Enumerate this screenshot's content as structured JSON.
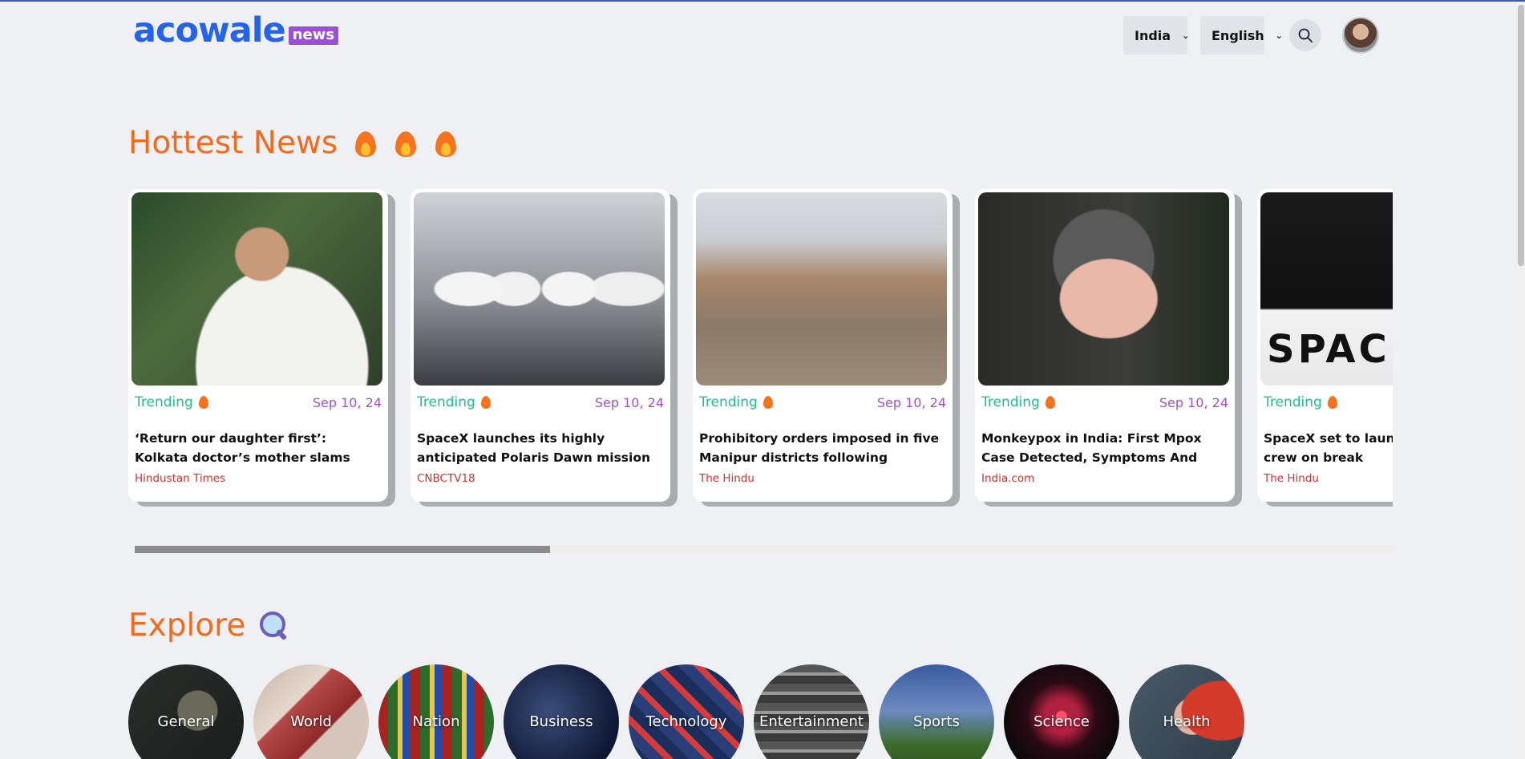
{
  "header": {
    "logo_main": "acowale",
    "logo_badge": "news",
    "country": "India",
    "language": "English"
  },
  "hottest": {
    "title": "Hottest News",
    "cards": [
      {
        "tag": "Trending",
        "date": "Sep 10, 24",
        "headline": "‘Return our daughter first’: Kolkata doctor’s mother slams Mamata",
        "source": "Hindustan Times"
      },
      {
        "tag": "Trending",
        "date": "Sep 10, 24",
        "headline": "SpaceX launches its highly anticipated Polaris Dawn mission",
        "source": "CNBCTV18"
      },
      {
        "tag": "Trending",
        "date": "Sep 10, 24",
        "headline": "Prohibitory orders imposed in five Manipur districts following student",
        "source": "The Hindu"
      },
      {
        "tag": "Trending",
        "date": "Sep 10, 24",
        "headline": "Monkeypox in India: First Mpox Case Detected, Symptoms And",
        "source": "India.com"
      },
      {
        "tag": "Trending",
        "date": "",
        "headline": "SpaceX set to launch b private crew on break",
        "source": "The Hindu",
        "image_text": "SPAC"
      }
    ]
  },
  "explore": {
    "title": "Explore",
    "categories": [
      "General",
      "World",
      "Nation",
      "Business",
      "Technology",
      "Entertainment",
      "Sports",
      "Science",
      "Health"
    ]
  },
  "icons": {
    "search": "search-icon",
    "chevron": "chevron-down-icon",
    "fire": "fire-icon",
    "magnifier": "magnifying-glass-icon"
  },
  "colors": {
    "accent_orange": "#f26b1d",
    "logo_blue": "#2563eb",
    "badge_purple": "#9b4fd8",
    "trending_green": "#1fbf8f",
    "date_purple": "#a04fd6",
    "source_red": "#d32f2f"
  },
  "carousel_scroll_fraction": 0.33
}
